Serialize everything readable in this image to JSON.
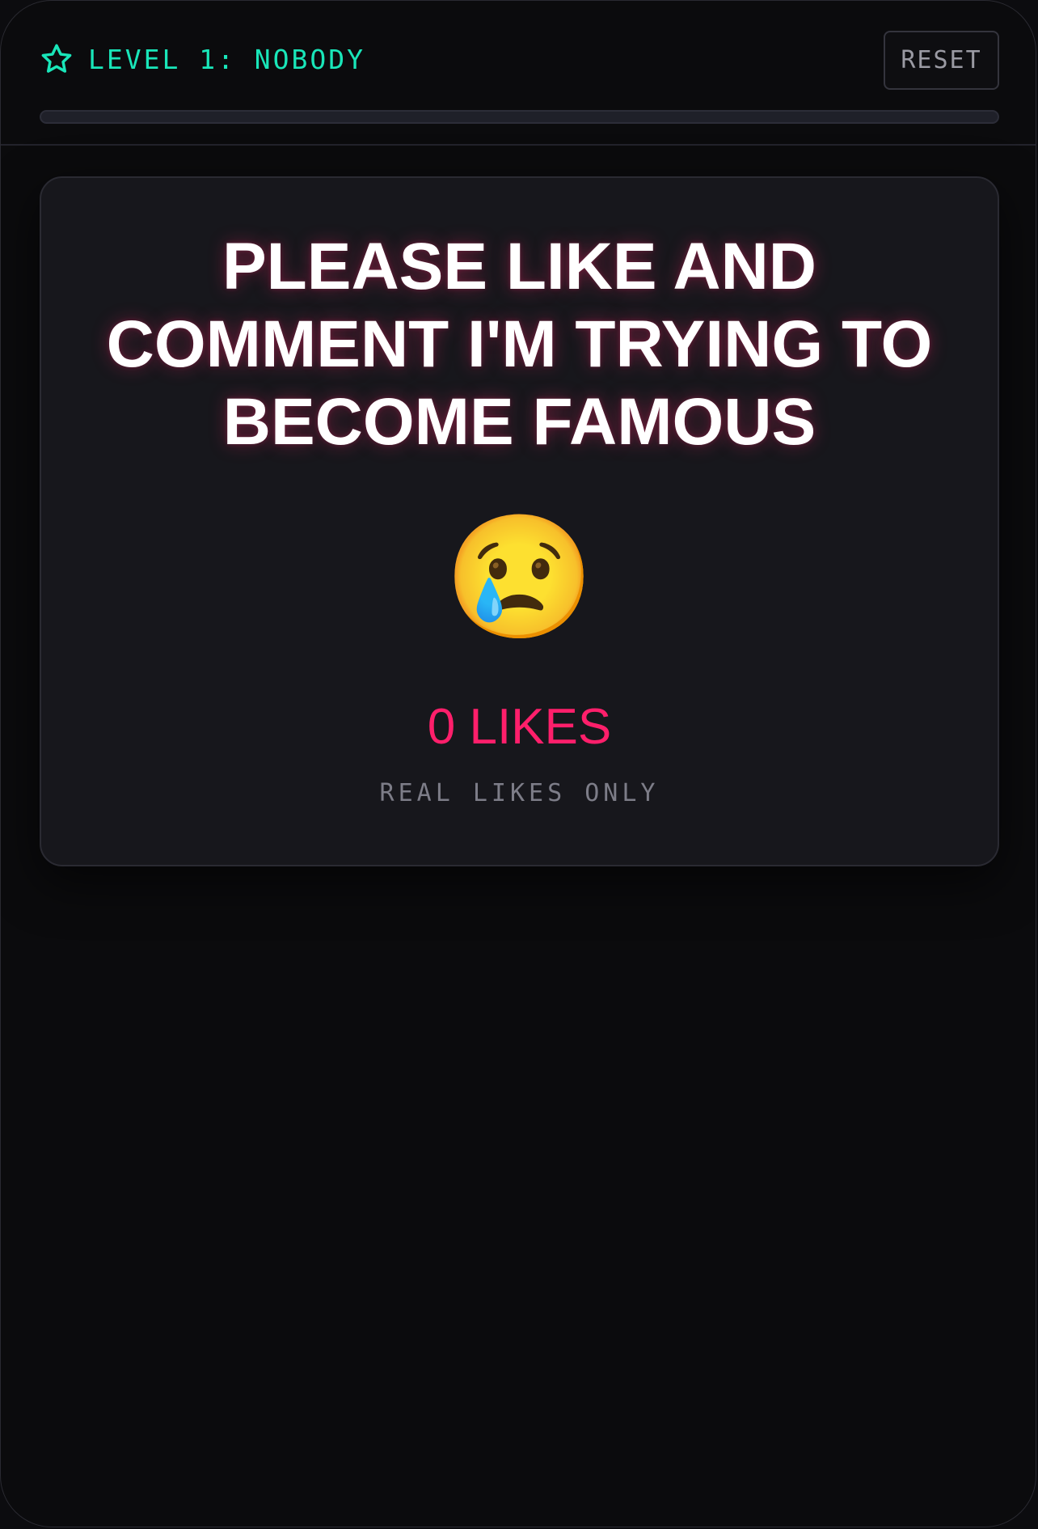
{
  "header": {
    "level_label": "LEVEL 1: NOBODY",
    "level_icon": "star-outline-icon",
    "reset_label": "RESET",
    "progress_fraction": 0
  },
  "card": {
    "headline": "PLEASE LIKE AND COMMENT I'M TRYING TO BECOME FAMOUS",
    "emoji": "😢",
    "likes": "0 LIKES",
    "note": "REAL LIKES ONLY"
  },
  "colors": {
    "accent": "#19e6b9",
    "likes": "#ff1f6b",
    "background": "#0b0b0d",
    "card": "#17171c"
  }
}
